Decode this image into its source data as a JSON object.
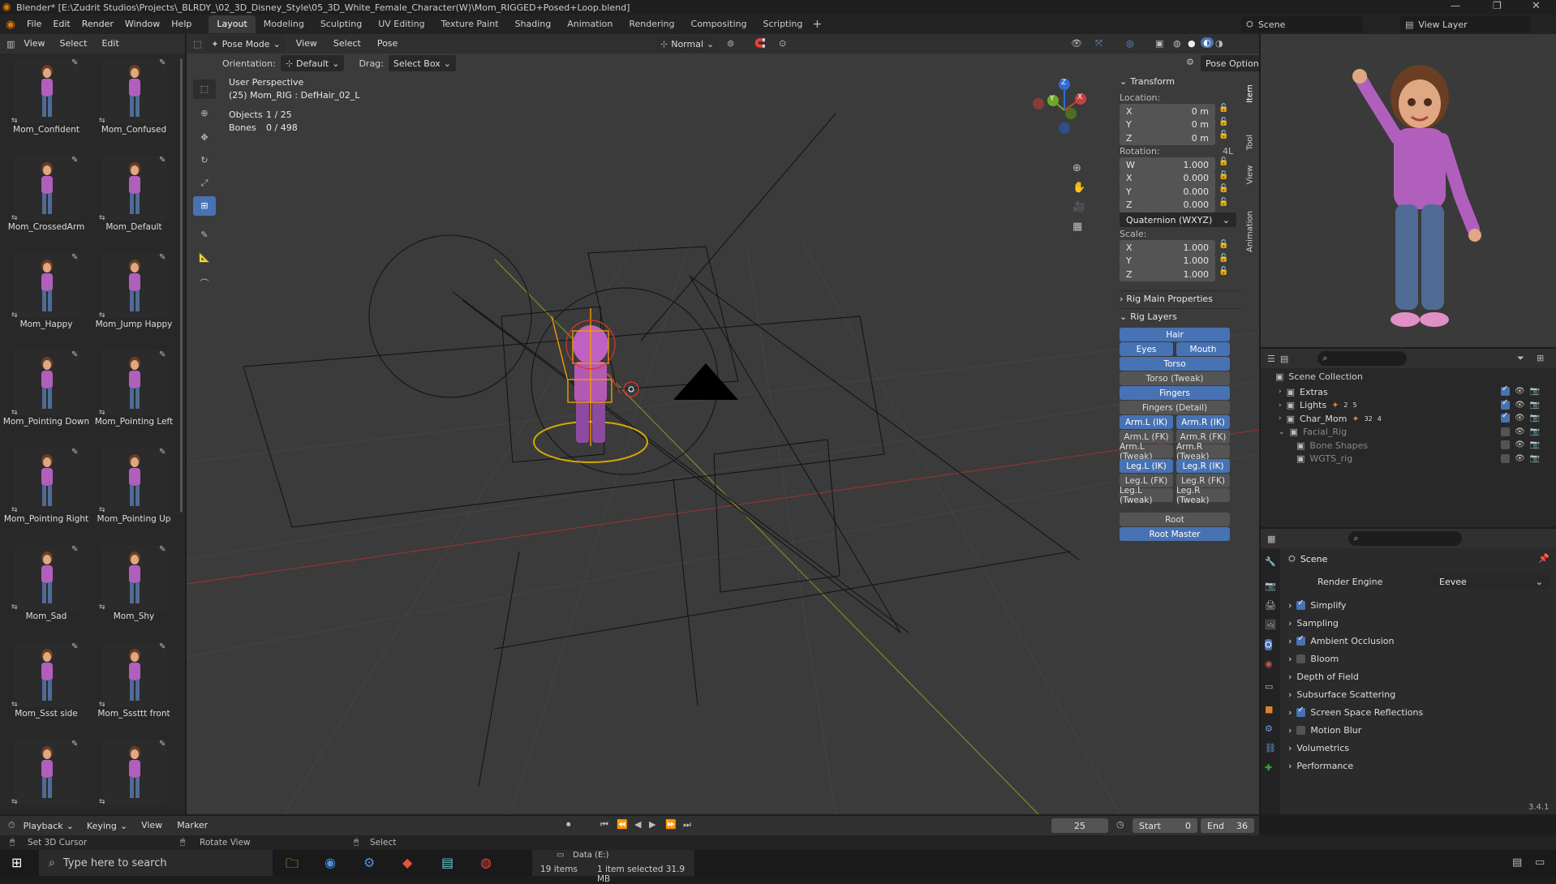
{
  "title_bar": {
    "title": "Blender* [E:\\Zudrit Studios\\Projects\\_BLRDY_\\02_3D_Disney_Style\\05_3D_White_Female_Character(W)\\Mom_RIGGED+Posed+Loop.blend]"
  },
  "menus": [
    "File",
    "Edit",
    "Render",
    "Window",
    "Help"
  ],
  "workspaces": [
    "Layout",
    "Modeling",
    "Sculpting",
    "UV Editing",
    "Texture Paint",
    "Shading",
    "Animation",
    "Rendering",
    "Compositing",
    "Scripting"
  ],
  "active_workspace": "Layout",
  "scene": {
    "name": "Scene",
    "view_layer": "View Layer"
  },
  "asset_browser": {
    "menus": [
      "View",
      "Select",
      "Edit"
    ],
    "poses": [
      "Mom_Confident",
      "Mom_Confused",
      "Mom_CrossedArm",
      "Mom_Default",
      "Mom_Happy",
      "Mom_Jump Happy",
      "Mom_Pointing Down",
      "Mom_Pointing Left",
      "Mom_Pointing Right",
      "Mom_Pointing Up",
      "Mom_Sad",
      "Mom_Shy",
      "Mom_Ssst side",
      "Mom_Sssttt front"
    ]
  },
  "viewport_header": {
    "mode": "Pose Mode",
    "menus": [
      "View",
      "Select",
      "Pose"
    ],
    "transform_orientation": "Normal",
    "orientation_label": "Orientation:",
    "orientation_value": "Default",
    "drag_label": "Drag:",
    "drag_value": "Select Box",
    "pose_options": "Pose Options"
  },
  "viewport_info": {
    "perspective": "User Perspective",
    "active": "(25) Mom_RIG : DefHair_02_L",
    "objects_label": "Objects",
    "objects": "1 / 25",
    "bones_label": "Bones",
    "bones": "0 / 498"
  },
  "gizmo": {
    "x": "X",
    "y": "Y",
    "z": "Z"
  },
  "sidebar_tabs": [
    "Item",
    "Tool",
    "View",
    "Animation"
  ],
  "transform": {
    "header": "Transform",
    "location_label": "Location:",
    "location": [
      {
        "axis": "X",
        "value": "0 m"
      },
      {
        "axis": "Y",
        "value": "0 m"
      },
      {
        "axis": "Z",
        "value": "0 m"
      }
    ],
    "rotation_label": "Rotation:",
    "rotation_mode_short": "4L",
    "rotation": [
      {
        "axis": "W",
        "value": "1.000"
      },
      {
        "axis": "X",
        "value": "0.000"
      },
      {
        "axis": "Y",
        "value": "0.000"
      },
      {
        "axis": "Z",
        "value": "0.000"
      }
    ],
    "rotation_mode": "Quaternion (WXYZ)",
    "scale_label": "Scale:",
    "scale": [
      {
        "axis": "X",
        "value": "1.000"
      },
      {
        "axis": "Y",
        "value": "1.000"
      },
      {
        "axis": "Z",
        "value": "1.000"
      }
    ]
  },
  "rig_main": "Rig Main Properties",
  "rig_layers": {
    "header": "Rig Layers",
    "hair": "Hair",
    "eyes": "Eyes",
    "mouth": "Mouth",
    "torso": "Torso",
    "torso_tweak": "Torso (Tweak)",
    "fingers": "Fingers",
    "fingers_detail": "Fingers (Detail)",
    "arm_l_ik": "Arm.L (IK)",
    "arm_r_ik": "Arm.R (IK)",
    "arm_l_fk": "Arm.L (FK)",
    "arm_r_fk": "Arm.R (FK)",
    "arm_l_tweak": "Arm.L (Tweak)",
    "arm_r_tweak": "Arm.R (Tweak)",
    "leg_l_ik": "Leg.L (IK)",
    "leg_r_ik": "Leg.R (IK)",
    "leg_l_fk": "Leg.L (FK)",
    "leg_r_fk": "Leg.R (FK)",
    "leg_l_tweak": "Leg.L (Tweak)",
    "leg_r_tweak": "Leg.R (Tweak)",
    "root": "Root",
    "root_master": "Root Master"
  },
  "outliner": {
    "collection": "Scene Collection",
    "items": [
      {
        "name": "Extras"
      },
      {
        "name": "Lights",
        "badge1": "2",
        "badge2": "5"
      },
      {
        "name": "Char_Mom",
        "badge1": "32",
        "badge2": "4"
      },
      {
        "name": "Facial_Rig"
      },
      {
        "name": "Bone Shapes"
      },
      {
        "name": "WGTS_rig"
      }
    ]
  },
  "properties": {
    "context": "Scene",
    "render_engine_label": "Render Engine",
    "render_engine": "Eevee",
    "panels": [
      {
        "label": "Simplify",
        "checkbox": true,
        "checked": true
      },
      {
        "label": "Sampling",
        "checkbox": false
      },
      {
        "label": "Ambient Occlusion",
        "checkbox": true,
        "checked": true
      },
      {
        "label": "Bloom",
        "checkbox": true,
        "checked": false
      },
      {
        "label": "Depth of Field",
        "checkbox": false
      },
      {
        "label": "Subsurface Scattering",
        "checkbox": false
      },
      {
        "label": "Screen Space Reflections",
        "checkbox": true,
        "checked": true
      },
      {
        "label": "Motion Blur",
        "checkbox": true,
        "checked": false
      },
      {
        "label": "Volumetrics",
        "checkbox": false
      },
      {
        "label": "Performance",
        "checkbox": false
      }
    ]
  },
  "timeline": {
    "menus": [
      "Playback",
      "Keying",
      "View",
      "Marker"
    ],
    "current_frame": "25",
    "start_label": "Start",
    "start": "0",
    "end_label": "End",
    "end": "36"
  },
  "statusbar": {
    "left": "Set 3D Cursor",
    "mid": "Rotate View",
    "right": "Select",
    "version": "3.4.1"
  },
  "taskbar": {
    "search_placeholder": "Type here to search",
    "drive": "Data (E:)",
    "items_count": "19 items",
    "selection": "1 item selected 31.9 MB"
  },
  "colors": {
    "accent": "#4772b3",
    "bg": "#1d1d1d",
    "panel": "#303030"
  }
}
